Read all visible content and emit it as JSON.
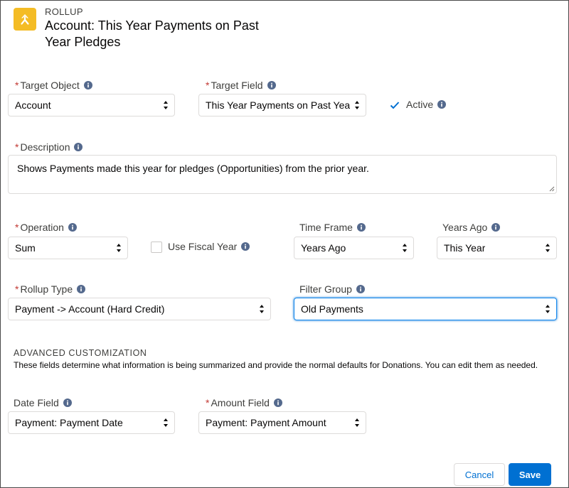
{
  "header": {
    "kicker": "ROLLUP",
    "title": "Account: This Year Payments on Past Year Pledges",
    "icon": "rollup-icon"
  },
  "fields": {
    "target_object": {
      "label": "Target Object",
      "required": true,
      "value": "Account"
    },
    "target_field": {
      "label": "Target Field",
      "required": true,
      "value": "This Year Payments on Past Year P"
    },
    "active": {
      "label": "Active",
      "checked": true
    },
    "description": {
      "label": "Description",
      "required": true,
      "value": "Shows Payments made this year for pledges (Opportunities) from the prior year."
    },
    "operation": {
      "label": "Operation",
      "required": true,
      "value": "Sum"
    },
    "use_fiscal_year": {
      "label": "Use Fiscal Year",
      "checked": false
    },
    "time_frame": {
      "label": "Time Frame",
      "value": "Years Ago"
    },
    "years_ago": {
      "label": "Years Ago",
      "value": "This Year"
    },
    "rollup_type": {
      "label": "Rollup Type",
      "required": true,
      "value": "Payment -> Account (Hard Credit)"
    },
    "filter_group": {
      "label": "Filter Group",
      "value": "Old Payments"
    },
    "date_field": {
      "label": "Date Field",
      "value": "Payment: Payment Date"
    },
    "amount_field": {
      "label": "Amount Field",
      "required": true,
      "value": "Payment: Payment Amount"
    }
  },
  "advanced": {
    "title": "ADVANCED CUSTOMIZATION",
    "description": "These fields determine what information is being summarized and provide the normal defaults for Donations. You can edit them as needed."
  },
  "buttons": {
    "cancel": "Cancel",
    "save": "Save"
  },
  "colors": {
    "brand": "#0070d2",
    "required": "#c23934",
    "icon_bg": "#f4bc25",
    "info_icon": "#54698d"
  }
}
